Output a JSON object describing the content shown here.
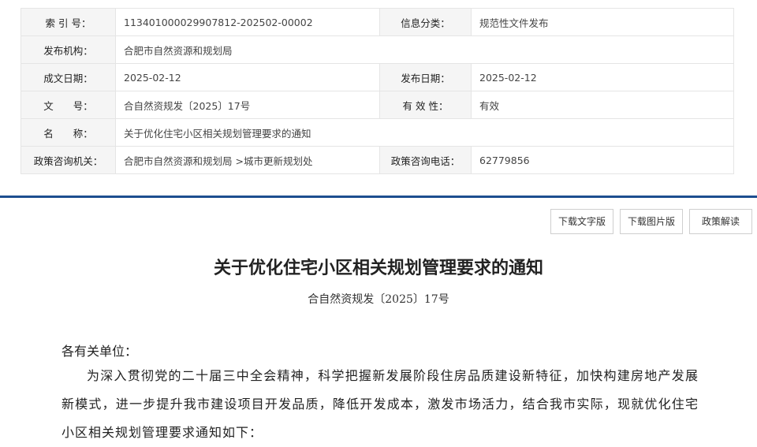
{
  "meta": {
    "index_label": "索 引 号：",
    "index_value": "113401000029907812-202502-00002",
    "category_label": "信息分类：",
    "category_value": "规范性文件发布",
    "issuer_label": "发布机构：",
    "issuer_value": "合肥市自然资源和规划局",
    "date_label": "成文日期：",
    "date_value": "2025-02-12",
    "pub_date_label": "发布日期：",
    "pub_date_value": "2025-02-12",
    "docno_label": "文　　号：",
    "docno_value": "合自然资规发〔2025〕17号",
    "validity_label": "有 效 性：",
    "validity_value": "有效",
    "name_label": "名　　称：",
    "name_value": "关于优化住宅小区相关规划管理要求的通知",
    "contact_org_label": "政策咨询机关：",
    "contact_org_value": "合肥市自然资源和规划局 >城市更新规划处",
    "contact_phone_label": "政策咨询电话：",
    "contact_phone_value": "62779856"
  },
  "buttons": {
    "text_version": "下载文字版",
    "image_version": "下载图片版",
    "interpretation": "政策解读"
  },
  "document": {
    "title": "关于优化住宅小区相关规划管理要求的通知",
    "number": "合自然资规发〔2025〕17号",
    "salutation": "各有关单位：",
    "paragraph": "为深入贯彻党的二十届三中全会精神，科学把握新发展阶段住房品质建设新特征，加快构建房地产发展新模式，进一步提升我市建设项目开发品质，降低开发成本，激发市场活力，结合我市实际，现就优化住宅小区相关规划管理要求通知如下："
  }
}
